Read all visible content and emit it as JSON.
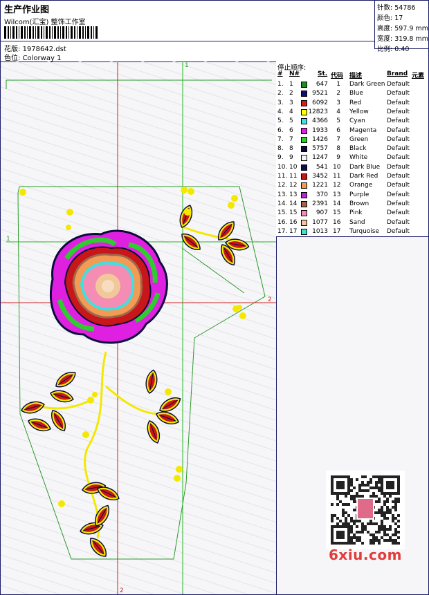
{
  "header": {
    "title": "生产作业图",
    "company": "Wilcom(汇宝) 整饰工作室",
    "pattern_label": "花版:",
    "pattern_value": "1978642.dst",
    "colorway_label": "色位:",
    "colorway_value": "Colorway 1"
  },
  "info": {
    "stitches_label": "针数:",
    "stitches_value": "54786",
    "colors_label": "颜色:",
    "colors_value": "17",
    "height_label": "高度:",
    "height_value": "597.9 mm",
    "width_label": "宽度:",
    "width_value": "319.8 mm",
    "scale_label": "比例:",
    "scale_value": "0.40"
  },
  "guides": {
    "v_green": "1",
    "h_green": "1",
    "h_red": "2",
    "v_red": "2"
  },
  "stop_sequence": {
    "title": "停止顺序:",
    "headers": {
      "num": "#",
      "n": "N#",
      "stitches": "St.",
      "code": "代码",
      "desc": "描述",
      "brand": "Brand",
      "extra": "元素"
    },
    "rows": [
      {
        "num": "1.",
        "n": "1",
        "color": "#1e8c1e",
        "stitches": "647",
        "code": "1",
        "desc": "Dark Green",
        "brand": "Default"
      },
      {
        "num": "2.",
        "n": "2",
        "color": "#10106e",
        "stitches": "9521",
        "code": "2",
        "desc": "Blue",
        "brand": "Default"
      },
      {
        "num": "3.",
        "n": "3",
        "color": "#d91a1a",
        "stitches": "6092",
        "code": "3",
        "desc": "Red",
        "brand": "Default"
      },
      {
        "num": "4.",
        "n": "4",
        "color": "#ffff00",
        "stitches": "12823",
        "code": "4",
        "desc": "Yellow",
        "brand": "Default"
      },
      {
        "num": "5.",
        "n": "5",
        "color": "#3fe0e0",
        "stitches": "4366",
        "code": "5",
        "desc": "Cyan",
        "brand": "Default"
      },
      {
        "num": "6.",
        "n": "6",
        "color": "#e020e0",
        "stitches": "1933",
        "code": "6",
        "desc": "Magenta",
        "brand": "Default"
      },
      {
        "num": "7.",
        "n": "7",
        "color": "#2ecc2e",
        "stitches": "1426",
        "code": "7",
        "desc": "Green",
        "brand": "Default"
      },
      {
        "num": "8.",
        "n": "8",
        "color": "#0a0a3c",
        "stitches": "5757",
        "code": "8",
        "desc": "Black",
        "brand": "Default"
      },
      {
        "num": "9.",
        "n": "9",
        "color": "#f4f4f4",
        "stitches": "1247",
        "code": "9",
        "desc": "White",
        "brand": "Default"
      },
      {
        "num": "10.",
        "n": "10",
        "color": "#0c0c50",
        "stitches": "541",
        "code": "10",
        "desc": "Dark Blue",
        "brand": "Default"
      },
      {
        "num": "11.",
        "n": "11",
        "color": "#c01818",
        "stitches": "3452",
        "code": "11",
        "desc": "Dark Red",
        "brand": "Default"
      },
      {
        "num": "12.",
        "n": "12",
        "color": "#f39a55",
        "stitches": "1221",
        "code": "12",
        "desc": "Orange",
        "brand": "Default"
      },
      {
        "num": "13.",
        "n": "13",
        "color": "#b228d8",
        "stitches": "370",
        "code": "13",
        "desc": "Purple",
        "brand": "Default"
      },
      {
        "num": "14.",
        "n": "14",
        "color": "#a0684a",
        "stitches": "2391",
        "code": "14",
        "desc": "Brown",
        "brand": "Default"
      },
      {
        "num": "15.",
        "n": "15",
        "color": "#f48cb4",
        "stitches": "907",
        "code": "15",
        "desc": "Pink",
        "brand": "Default"
      },
      {
        "num": "16.",
        "n": "16",
        "color": "#f2c89a",
        "stitches": "1077",
        "code": "16",
        "desc": "Sand",
        "brand": "Default"
      },
      {
        "num": "17.",
        "n": "17",
        "color": "#40e0d0",
        "stitches": "1013",
        "code": "17",
        "desc": "Turquoise",
        "brand": "Default"
      }
    ]
  },
  "watermark": {
    "site": "6xiu.com",
    "qr_icon": "qr-code-icon",
    "seal_icon": "seal-stamp-icon"
  }
}
